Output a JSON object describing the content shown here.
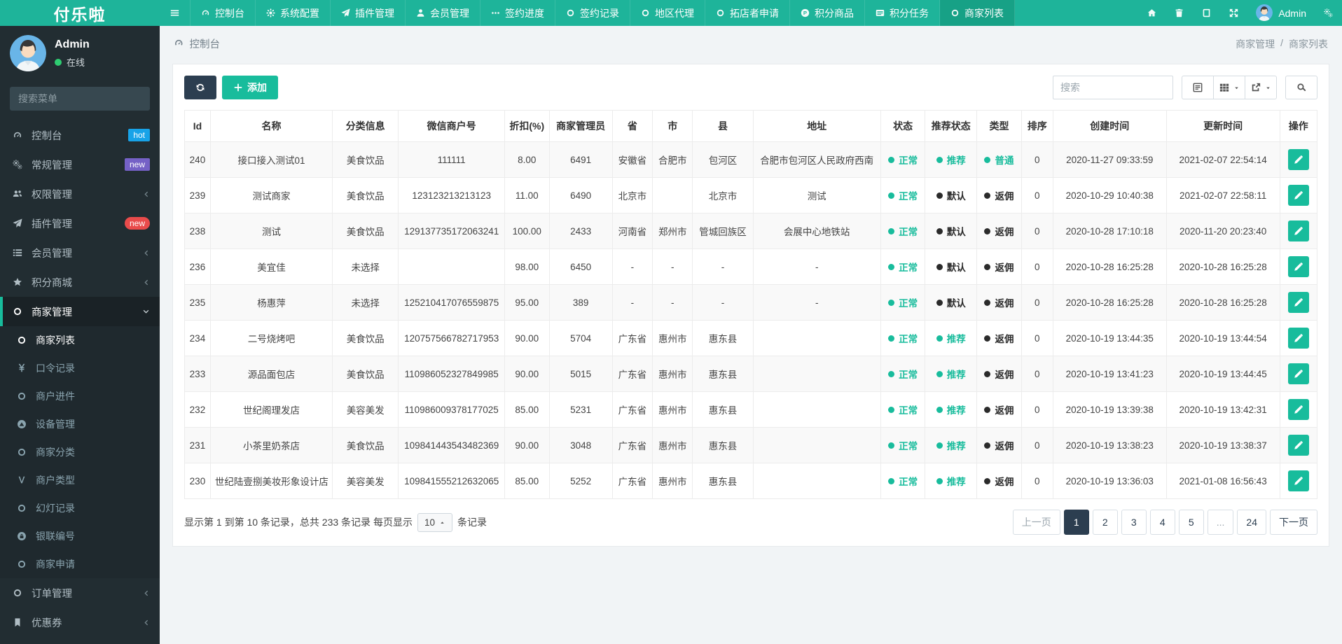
{
  "brand": "付乐啦",
  "topnav": {
    "items": [
      {
        "icon": "bars",
        "label": ""
      },
      {
        "icon": "gauge",
        "label": "控制台"
      },
      {
        "icon": "gear",
        "label": "系统配置"
      },
      {
        "icon": "plane",
        "label": "插件管理"
      },
      {
        "icon": "user",
        "label": "会员管理"
      },
      {
        "icon": "ellipsis",
        "label": "签约进度"
      },
      {
        "icon": "circle",
        "label": "签约记录"
      },
      {
        "icon": "circle",
        "label": "地区代理"
      },
      {
        "icon": "circle",
        "label": "拓店者申请"
      },
      {
        "icon": "circle-p",
        "label": "积分商品"
      },
      {
        "icon": "list",
        "label": "积分任务"
      },
      {
        "icon": "circle",
        "label": "商家列表",
        "active": true
      }
    ],
    "right_icons": [
      {
        "icon": "home"
      },
      {
        "icon": "trash"
      },
      {
        "icon": "book"
      },
      {
        "icon": "expand"
      }
    ],
    "user_label": "Admin"
  },
  "sidebar": {
    "user": {
      "name": "Admin",
      "status": "在线"
    },
    "search_placeholder": "搜索菜单",
    "menu": [
      {
        "icon": "gauge",
        "label": "控制台",
        "badge": "hot",
        "badge_color": "#18a3e8"
      },
      {
        "icon": "cogs",
        "label": "常规管理",
        "badge": "new",
        "badge_color": "#7561c6"
      },
      {
        "icon": "users",
        "label": "权限管理",
        "arrow": "left"
      },
      {
        "icon": "plane",
        "label": "插件管理",
        "badge": "new",
        "badge_color": "#e94b4b",
        "badge_pill": true
      },
      {
        "icon": "listb",
        "label": "会员管理",
        "arrow": "left"
      },
      {
        "icon": "star",
        "label": "积分商城",
        "arrow": "left"
      },
      {
        "icon": "circle",
        "label": "商家管理",
        "arrow": "down",
        "active": true,
        "children": [
          {
            "icon": "circle",
            "label": "商家列表",
            "active": true
          },
          {
            "icon": "yen",
            "label": "口令记录"
          },
          {
            "icon": "circle",
            "label": "商户进件"
          },
          {
            "icon": "adn",
            "label": "设备管理"
          },
          {
            "icon": "circle",
            "label": "商家分类"
          },
          {
            "icon": "vine",
            "label": "商户类型"
          },
          {
            "icon": "circle",
            "label": "幻灯记录"
          },
          {
            "icon": "lock",
            "label": "银联编号"
          },
          {
            "icon": "circle",
            "label": "商家申请"
          }
        ]
      },
      {
        "icon": "circle",
        "label": "订单管理",
        "arrow": "left"
      },
      {
        "icon": "bookmark",
        "label": "优惠券",
        "arrow": "left"
      }
    ]
  },
  "breadcrumb": {
    "left": "控制台",
    "parent": "商家管理",
    "separator": "/",
    "current": "商家列表"
  },
  "toolbar": {
    "add_label": "添加",
    "search_placeholder": "搜索"
  },
  "table": {
    "headers": [
      "Id",
      "名称",
      "分类信息",
      "微信商户号",
      "折扣(%)",
      "商家管理员",
      "省",
      "市",
      "县",
      "地址",
      "状态",
      "推荐状态",
      "类型",
      "排序",
      "创建时间",
      "更新时间",
      "操作"
    ],
    "status_palette": {
      "green": "#18bc9c",
      "dark": "#2b2b2b"
    },
    "rows": [
      {
        "id": "240",
        "name": "接口接入测试01",
        "category": "美食饮品",
        "wechat_id": "111111",
        "discount": "8.00",
        "manager": "6491",
        "province": "安徽省",
        "city": "合肥市",
        "county": "包河区",
        "address": "合肥市包河区人民政府西南",
        "status": {
          "label": "正常",
          "color": "green"
        },
        "recommend": {
          "label": "推荐",
          "color": "green"
        },
        "type": {
          "label": "普通",
          "color": "green"
        },
        "sort": "0",
        "created": "2020-11-27 09:33:59",
        "updated": "2021-02-07 22:54:14"
      },
      {
        "id": "239",
        "name": "测试商家",
        "category": "美食饮品",
        "wechat_id": "123123213213123",
        "discount": "11.00",
        "manager": "6490",
        "province": "北京市",
        "city": "",
        "county": "北京市",
        "address": "测试",
        "status": {
          "label": "正常",
          "color": "green"
        },
        "recommend": {
          "label": "默认",
          "color": "dark"
        },
        "type": {
          "label": "返佣",
          "color": "dark"
        },
        "sort": "0",
        "created": "2020-10-29 10:40:38",
        "updated": "2021-02-07 22:58:11"
      },
      {
        "id": "238",
        "name": "测试",
        "category": "美食饮品",
        "wechat_id": "129137735172063241",
        "discount": "100.00",
        "manager": "2433",
        "province": "河南省",
        "city": "郑州市",
        "county": "管城回族区",
        "address": "会展中心地铁站",
        "status": {
          "label": "正常",
          "color": "green"
        },
        "recommend": {
          "label": "默认",
          "color": "dark"
        },
        "type": {
          "label": "返佣",
          "color": "dark"
        },
        "sort": "0",
        "created": "2020-10-28 17:10:18",
        "updated": "2020-11-20 20:23:40"
      },
      {
        "id": "236",
        "name": "美宜佳",
        "category": "未选择",
        "wechat_id": "",
        "discount": "98.00",
        "manager": "6450",
        "province": "-",
        "city": "-",
        "county": "-",
        "address": "-",
        "status": {
          "label": "正常",
          "color": "green"
        },
        "recommend": {
          "label": "默认",
          "color": "dark"
        },
        "type": {
          "label": "返佣",
          "color": "dark"
        },
        "sort": "0",
        "created": "2020-10-28 16:25:28",
        "updated": "2020-10-28 16:25:28"
      },
      {
        "id": "235",
        "name": "杨惠萍",
        "category": "未选择",
        "wechat_id": "125210417076559875",
        "discount": "95.00",
        "manager": "389",
        "province": "-",
        "city": "-",
        "county": "-",
        "address": "-",
        "status": {
          "label": "正常",
          "color": "green"
        },
        "recommend": {
          "label": "默认",
          "color": "dark"
        },
        "type": {
          "label": "返佣",
          "color": "dark"
        },
        "sort": "0",
        "created": "2020-10-28 16:25:28",
        "updated": "2020-10-28 16:25:28"
      },
      {
        "id": "234",
        "name": "二号烧烤吧",
        "category": "美食饮品",
        "wechat_id": "120757566782717953",
        "discount": "90.00",
        "manager": "5704",
        "province": "广东省",
        "city": "惠州市",
        "county": "惠东县",
        "address": "",
        "status": {
          "label": "正常",
          "color": "green"
        },
        "recommend": {
          "label": "推荐",
          "color": "green"
        },
        "type": {
          "label": "返佣",
          "color": "dark"
        },
        "sort": "0",
        "created": "2020-10-19 13:44:35",
        "updated": "2020-10-19 13:44:54"
      },
      {
        "id": "233",
        "name": "源品面包店",
        "category": "美食饮品",
        "wechat_id": "110986052327849985",
        "discount": "90.00",
        "manager": "5015",
        "province": "广东省",
        "city": "惠州市",
        "county": "惠东县",
        "address": "",
        "status": {
          "label": "正常",
          "color": "green"
        },
        "recommend": {
          "label": "推荐",
          "color": "green"
        },
        "type": {
          "label": "返佣",
          "color": "dark"
        },
        "sort": "0",
        "created": "2020-10-19 13:41:23",
        "updated": "2020-10-19 13:44:45"
      },
      {
        "id": "232",
        "name": "世纪阁理发店",
        "category": "美容美发",
        "wechat_id": "110986009378177025",
        "discount": "85.00",
        "manager": "5231",
        "province": "广东省",
        "city": "惠州市",
        "county": "惠东县",
        "address": "",
        "status": {
          "label": "正常",
          "color": "green"
        },
        "recommend": {
          "label": "推荐",
          "color": "green"
        },
        "type": {
          "label": "返佣",
          "color": "dark"
        },
        "sort": "0",
        "created": "2020-10-19 13:39:38",
        "updated": "2020-10-19 13:42:31"
      },
      {
        "id": "231",
        "name": "小茶里奶茶店",
        "category": "美食饮品",
        "wechat_id": "109841443543482369",
        "discount": "90.00",
        "manager": "3048",
        "province": "广东省",
        "city": "惠州市",
        "county": "惠东县",
        "address": "",
        "status": {
          "label": "正常",
          "color": "green"
        },
        "recommend": {
          "label": "推荐",
          "color": "green"
        },
        "type": {
          "label": "返佣",
          "color": "dark"
        },
        "sort": "0",
        "created": "2020-10-19 13:38:23",
        "updated": "2020-10-19 13:38:37"
      },
      {
        "id": "230",
        "name": "世纪陆壹捌美妆形象设计店",
        "category": "美容美发",
        "wechat_id": "109841555212632065",
        "discount": "85.00",
        "manager": "5252",
        "province": "广东省",
        "city": "惠州市",
        "county": "惠东县",
        "address": "",
        "status": {
          "label": "正常",
          "color": "green"
        },
        "recommend": {
          "label": "推荐",
          "color": "green"
        },
        "type": {
          "label": "返佣",
          "color": "dark"
        },
        "sort": "0",
        "created": "2020-10-19 13:36:03",
        "updated": "2021-01-08 16:56:43"
      }
    ]
  },
  "pagination": {
    "info_prefix": "显示第 1 到第 10 条记录，总共 233 条记录 每页显示",
    "page_size": "10",
    "info_suffix": "条记录",
    "prev": "上一页",
    "next": "下一页",
    "pages": [
      "1",
      "2",
      "3",
      "4",
      "5",
      "...",
      "24"
    ],
    "active_page": "1"
  }
}
